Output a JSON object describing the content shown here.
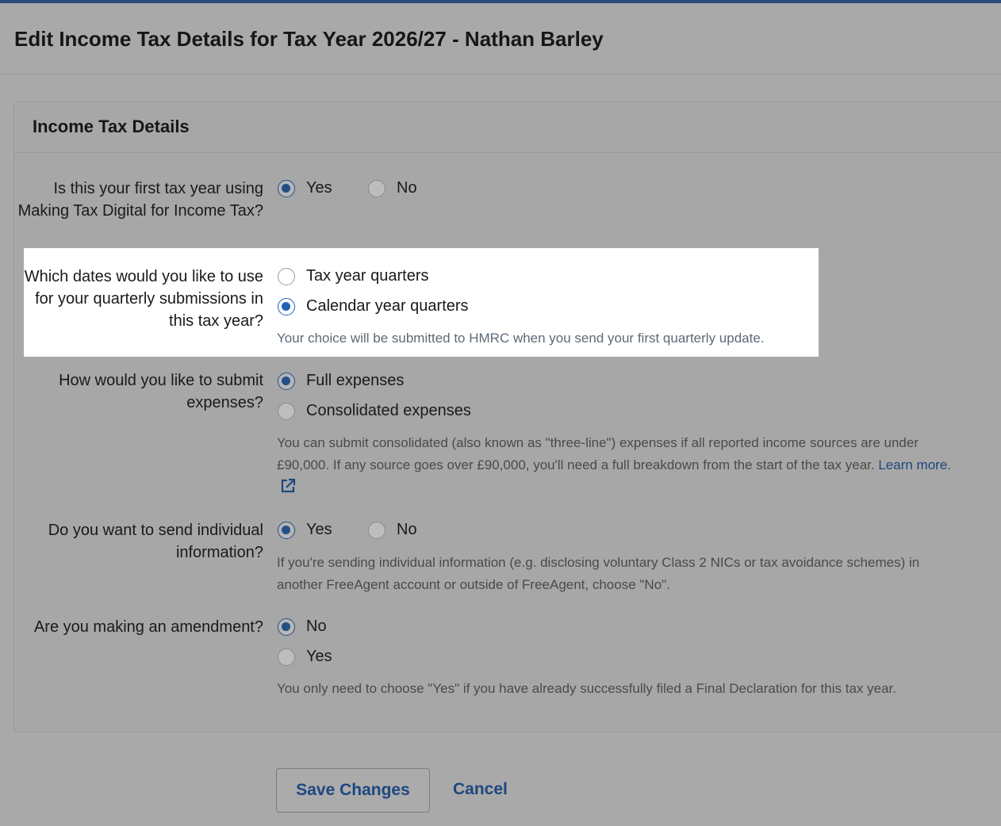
{
  "page": {
    "title": "Edit Income Tax Details for Tax Year 2026/27 - Nathan Barley"
  },
  "card": {
    "title": "Income Tax Details"
  },
  "q1": {
    "label": "Is this your first tax year using Making Tax Digital for Income Tax?",
    "options": [
      "Yes",
      "No"
    ],
    "selected": "Yes"
  },
  "q2": {
    "label": "Which dates would you like to use for your quarterly submissions in this tax year?",
    "options": [
      "Tax year quarters",
      "Calendar year quarters"
    ],
    "selected": "Calendar year quarters",
    "hint": "Your choice will be submitted to HMRC when you send your first quarterly update."
  },
  "q3": {
    "label": "How would you like to submit expenses?",
    "options": [
      "Full expenses",
      "Consolidated expenses"
    ],
    "selected": "Full expenses",
    "hint": "You can submit consolidated (also known as \"three-line\") expenses if all reported income sources are under £90,000. If any source goes over £90,000, you'll need a full breakdown from the start of the tax year.",
    "link": "Learn more."
  },
  "q4": {
    "label": "Do you want to send individual information?",
    "options": [
      "Yes",
      "No"
    ],
    "selected": "Yes",
    "hint": "If you're sending individual information (e.g. disclosing voluntary Class 2 NICs or tax avoidance schemes) in another FreeAgent account or outside of FreeAgent, choose \"No\"."
  },
  "q5": {
    "label": "Are you making an amendment?",
    "options": [
      "No",
      "Yes"
    ],
    "selected": "No",
    "hint": "You only need to choose \"Yes\" if you have already successfully filed a Final Declaration for this tax year."
  },
  "actions": {
    "save_label": "Save Changes",
    "cancel_label": "Cancel"
  },
  "colors": {
    "accent": "#1d477f",
    "highlight_accent": "#1f62b8",
    "overlay": "#a9a9a9"
  },
  "icons": {
    "external_link": "external-link-icon"
  }
}
